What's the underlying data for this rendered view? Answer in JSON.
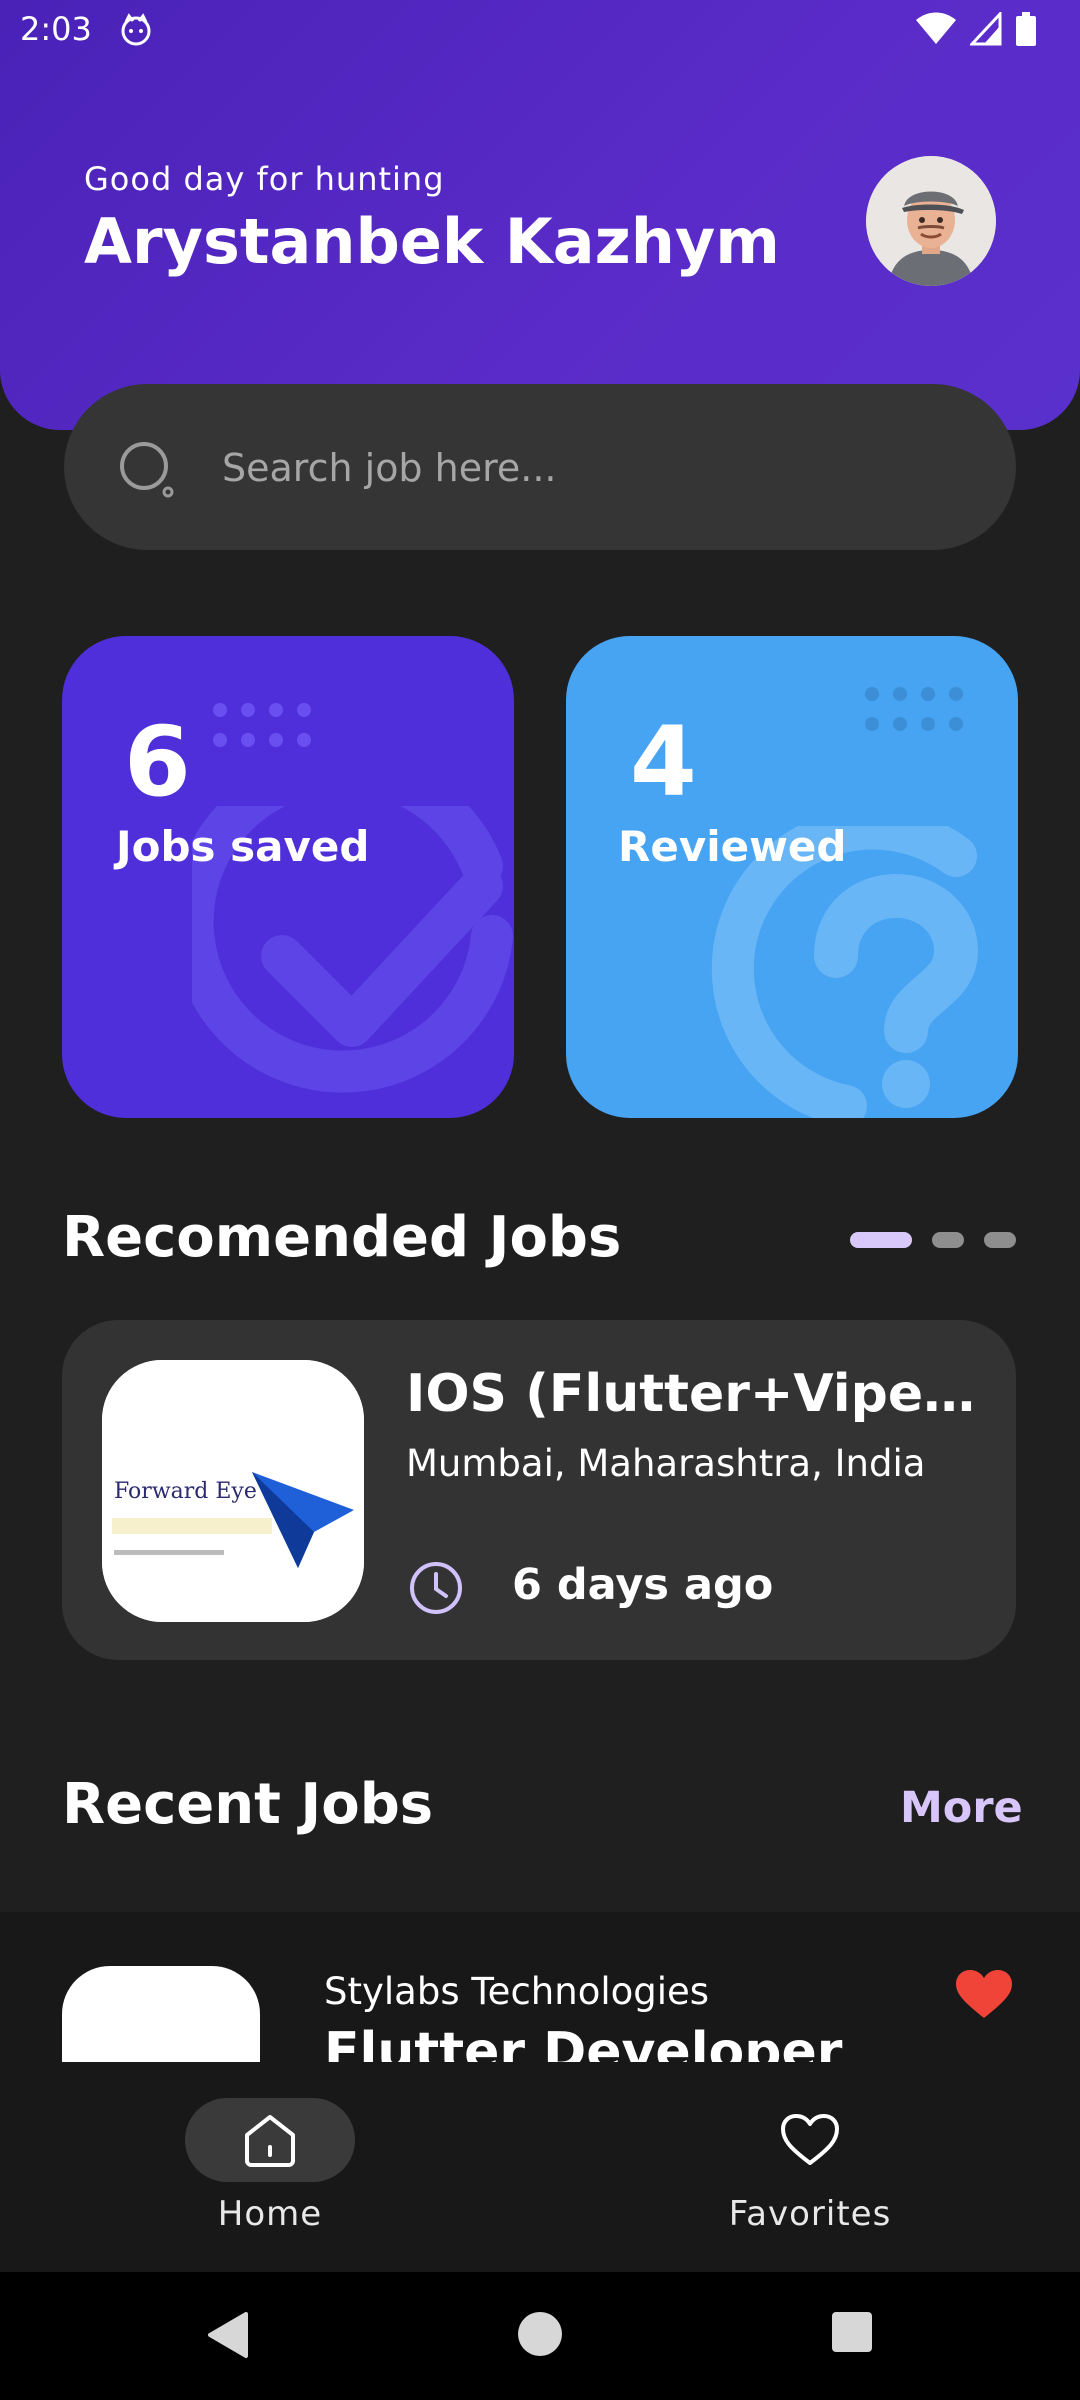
{
  "status_bar": {
    "time": "2:03"
  },
  "header": {
    "greeting": "Good day for hunting",
    "username": "Arystanbek Kazhym"
  },
  "search": {
    "placeholder": "Search job here..."
  },
  "stats": [
    {
      "value": "6",
      "label": "Jobs saved",
      "color": "#4f2fd9",
      "icon": "check-circle-icon"
    },
    {
      "value": "4",
      "label": "Reviewed",
      "color": "#46a4f2",
      "icon": "question-circle-icon"
    }
  ],
  "recommended": {
    "title": "Recomended Jobs",
    "page_indicator": {
      "pages": 3,
      "active": 1
    },
    "job": {
      "title": "IOS (Flutter+Viper+Swift)",
      "location": "Mumbai, Maharashtra, India",
      "posted": "6 days ago",
      "logo_text": "Forward Eye"
    }
  },
  "recent": {
    "title": "Recent Jobs",
    "more_label": "More",
    "job": {
      "company": "Stylabs Technologies",
      "title": "Flutter Developer",
      "favorited": true
    }
  },
  "bottom_nav": {
    "items": [
      {
        "label": "Home",
        "icon": "home-icon",
        "active": true
      },
      {
        "label": "Favorites",
        "icon": "heart-icon",
        "active": false
      }
    ]
  },
  "colors": {
    "accent": "#5a2bc8",
    "secondary": "#46a4f2",
    "highlight": "#d8c6fb",
    "favorite": "#f04438"
  }
}
